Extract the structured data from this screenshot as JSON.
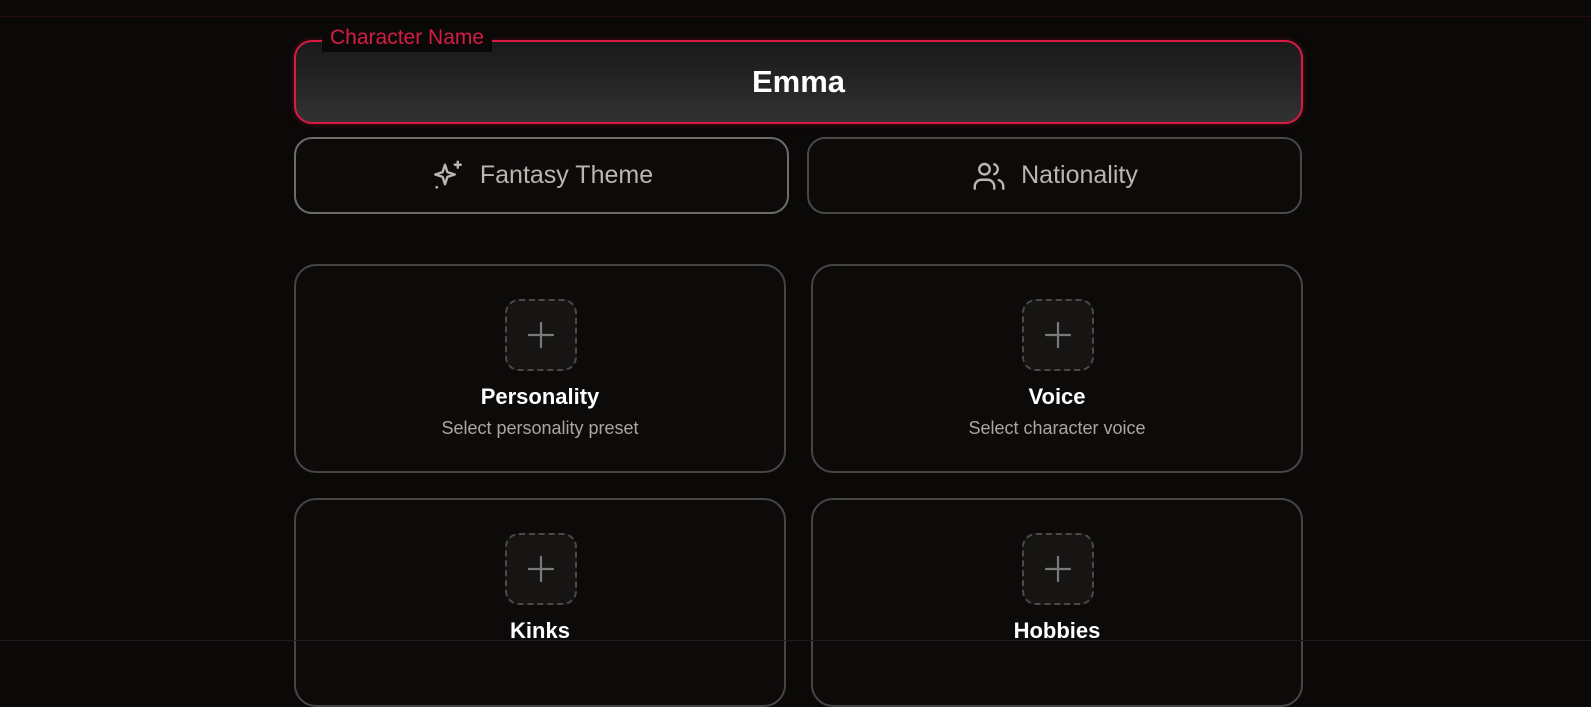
{
  "character_name": {
    "legend": "Character Name",
    "value": "Emma"
  },
  "selectors": {
    "theme_label": "Fantasy Theme",
    "theme_icon": "sparkles-icon",
    "nationality_label": "Nationality",
    "nationality_icon": "users-icon"
  },
  "cards": [
    {
      "title": "Personality",
      "subtitle": "Select personality preset"
    },
    {
      "title": "Voice",
      "subtitle": "Select character voice"
    },
    {
      "title": "Kinks",
      "subtitle": ""
    },
    {
      "title": "Hobbies",
      "subtitle": ""
    }
  ],
  "colors": {
    "accent": "#d81b45",
    "background": "#0a0908",
    "card_border": "#474544",
    "text_primary": "#ffffff",
    "text_secondary": "#a9a6a4"
  }
}
